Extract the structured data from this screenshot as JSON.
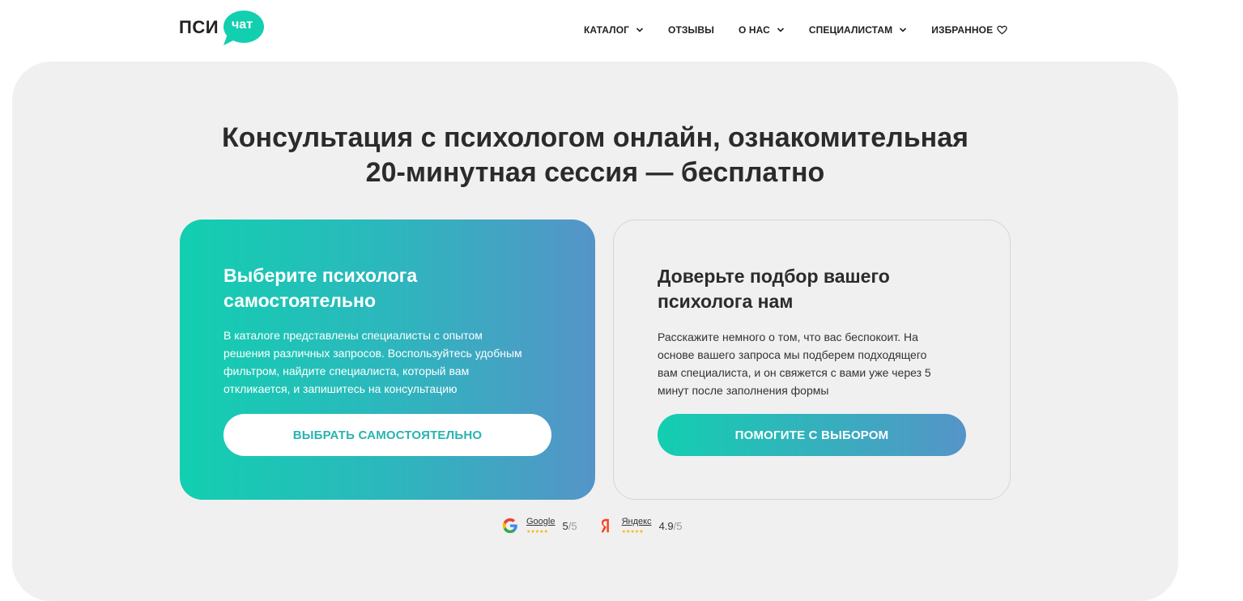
{
  "logo": {
    "main": "ПСИ",
    "bubble": "чат",
    "brand_color": "#12cfb0"
  },
  "nav": {
    "items": [
      {
        "label": "КАТАЛОГ",
        "has_dropdown": true
      },
      {
        "label": "ОТЗЫВЫ",
        "has_dropdown": false
      },
      {
        "label": "О НАС",
        "has_dropdown": true
      },
      {
        "label": "СПЕЦИАЛИСТАМ",
        "has_dropdown": true
      },
      {
        "label": "ИЗБРАННОЕ",
        "icon": "heart-icon"
      }
    ]
  },
  "hero": {
    "title_line1": "Консультация с психологом онлайн, ознакомительная",
    "title_line2": "20-минутная сессия — бесплатно"
  },
  "cards": {
    "self": {
      "title_line1": "Выберите психолога",
      "title_line2": "самостоятельно",
      "text_line1": "В каталоге представлены специалисты с опытом",
      "text_line2": "решения различных запросов. Воспользуйтесь удобным",
      "text_line3": "фильтром, найдите специалиста, который вам",
      "text_line4": "откликается, и запишитесь на консультацию",
      "button": "Выбрать самостоятельно"
    },
    "assist": {
      "title_line1": "Доверьте подбор вашего",
      "title_line2": "психолога нам",
      "text_line1": "Расскажите немного о том, что вас беспокоит. На",
      "text_line2": "основе вашего запроса мы подберем подходящего",
      "text_line3": "вам специалиста, и он свяжется с вами уже через 5",
      "text_line4": "минут после заполнения формы",
      "button": "Помогите с выбором"
    }
  },
  "ratings": [
    {
      "source": "Google",
      "icon": "google-icon",
      "score": "5",
      "max": "/5",
      "stars": "★★★★★"
    },
    {
      "source": "Яндекс",
      "icon": "yandex-icon",
      "score": "4.9",
      "max": "/5",
      "stars": "★★★★★"
    }
  ],
  "colors": {
    "accent_start": "#12cfb0",
    "accent_end": "#5594c8",
    "panel_bg": "#f0f0f0"
  }
}
